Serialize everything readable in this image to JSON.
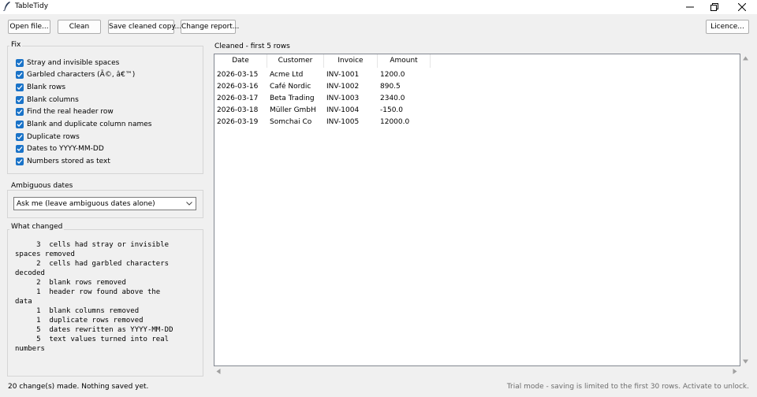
{
  "window": {
    "title": "TableTidy"
  },
  "toolbar": {
    "open": "Open file...",
    "clean": "Clean",
    "save": "Save cleaned copy...",
    "report": "Change report...",
    "licence": "Licence..."
  },
  "fix": {
    "label": "Fix",
    "options": [
      {
        "label": "Stray and invisible spaces",
        "checked": true
      },
      {
        "label": "Garbled characters (Ã©, â€™)",
        "checked": true
      },
      {
        "label": "Blank rows",
        "checked": true
      },
      {
        "label": "Blank columns",
        "checked": true
      },
      {
        "label": "Find the real header row",
        "checked": true
      },
      {
        "label": "Blank and duplicate column names",
        "checked": true
      },
      {
        "label": "Duplicate rows",
        "checked": true
      },
      {
        "label": "Dates to YYYY-MM-DD",
        "checked": true
      },
      {
        "label": "Numbers stored as text",
        "checked": true
      }
    ]
  },
  "ambiguous": {
    "label": "Ambiguous dates",
    "selected": "Ask me (leave ambiguous dates alone)"
  },
  "changes": {
    "label": "What changed",
    "text": "     3  cells had stray or invisible\nspaces removed\n     2  cells had garbled characters\ndecoded\n     2  blank rows removed\n     1  header row found above the\ndata\n     1  blank columns removed\n     1  duplicate rows removed\n     5  dates rewritten as YYYY-MM-DD\n     5  text values turned into real\nnumbers"
  },
  "preview": {
    "label": "Cleaned - first 5 rows",
    "columns": [
      "Date",
      "Customer",
      "Invoice",
      "Amount"
    ],
    "rows": [
      [
        "2026-03-15",
        "Acme Ltd",
        "INV-1001",
        "1200.0"
      ],
      [
        "2026-03-16",
        "Café Nordic",
        "INV-1002",
        "890.5"
      ],
      [
        "2026-03-17",
        "Beta Trading",
        "INV-1003",
        "2340.0"
      ],
      [
        "2026-03-18",
        "Müller GmbH",
        "INV-1004",
        "-150.0"
      ],
      [
        "2026-03-19",
        "Somchai Co",
        "INV-1005",
        "12000.0"
      ]
    ]
  },
  "status": {
    "left": "20 change(s) made. Nothing saved yet.",
    "right": "Trial mode - saving is limited to the first 30 rows. Activate to unlock."
  },
  "colors": {
    "checkbox": "#1a73c8"
  }
}
